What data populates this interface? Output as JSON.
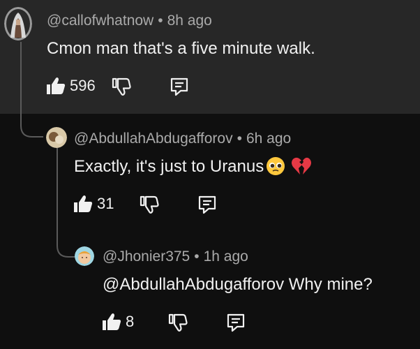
{
  "comments": [
    {
      "author": "@callofwhatnow",
      "separator": "•",
      "time": "8h ago",
      "text": "Cmon man that's a five minute walk.",
      "likes": "596"
    },
    {
      "author": "@AbdullahAbdugafforov",
      "separator": "•",
      "time": "6h ago",
      "text": "Exactly, it's just to Uranus",
      "likes": "31",
      "emojis": [
        "pleading-face-emoji",
        "broken-heart-emoji"
      ]
    },
    {
      "author": "@Jhonier375",
      "separator": "•",
      "time": "1h ago",
      "text": "@AbdullahAbdugafforov Why mine?",
      "likes": "8"
    }
  ],
  "icons": {
    "like": "thumbs-up-icon",
    "dislike": "thumbs-down-icon",
    "reply": "reply-comment-icon"
  },
  "colors": {
    "background": "#0f0f0f",
    "top_panel": "#272727",
    "text": "#f1f1f1",
    "meta": "#aaaaaa",
    "thread_line": "#5a5a5a"
  }
}
